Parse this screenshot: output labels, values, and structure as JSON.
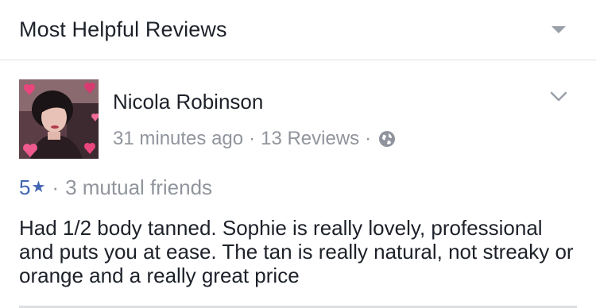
{
  "header": {
    "title": "Most Helpful Reviews",
    "dropdown_icon": "caret-down-icon"
  },
  "review": {
    "author": "Nicola Robinson",
    "time": "31 minutes ago",
    "separator": "·",
    "review_count": "13 Reviews",
    "privacy_icon": "globe-icon",
    "rating": "5",
    "rating_icon": "★",
    "mutual_friends": "3 mutual friends",
    "text": "Had 1/2 body tanned. Sophie is really lovely, professional and puts you at ease. The tan is really natural, not streaky or orange and a really great price",
    "options_icon": "chevron-down-icon"
  },
  "colors": {
    "text": "#1d2129",
    "secondary": "#90949c",
    "accent": "#4267b2",
    "divider": "#dddfe2"
  }
}
